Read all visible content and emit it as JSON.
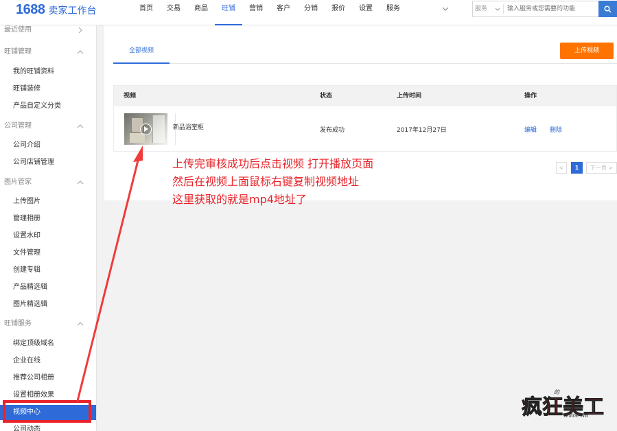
{
  "header": {
    "logo_number": "1688",
    "logo_text": "卖家工作台",
    "nav": [
      "首页",
      "交易",
      "商品",
      "旺铺",
      "营销",
      "客户",
      "分销",
      "报价",
      "设置",
      "服务"
    ],
    "search_scope": "服务",
    "search_placeholder": "输入服务或您需要的功能"
  },
  "sidebar": {
    "items": [
      {
        "label": "最近使用",
        "kind": "group"
      },
      {
        "label": "旺铺管理",
        "kind": "group"
      },
      {
        "label": "我的旺铺资料",
        "kind": "link"
      },
      {
        "label": "旺铺装修",
        "kind": "link"
      },
      {
        "label": "产品自定义分类",
        "kind": "link"
      },
      {
        "label": "公司管理",
        "kind": "group"
      },
      {
        "label": "公司介绍",
        "kind": "link"
      },
      {
        "label": "公司店铺管理",
        "kind": "link"
      },
      {
        "label": "图片管家",
        "kind": "group"
      },
      {
        "label": "上传图片",
        "kind": "link"
      },
      {
        "label": "管理相册",
        "kind": "link"
      },
      {
        "label": "设置水印",
        "kind": "link"
      },
      {
        "label": "文件管理",
        "kind": "link"
      },
      {
        "label": "创建专辑",
        "kind": "link"
      },
      {
        "label": "产品精选辑",
        "kind": "link"
      },
      {
        "label": "图片精选辑",
        "kind": "link"
      },
      {
        "label": "旺铺服务",
        "kind": "group"
      },
      {
        "label": "绑定顶级域名",
        "kind": "link"
      },
      {
        "label": "企业在线",
        "kind": "link"
      },
      {
        "label": "推荐公司相册",
        "kind": "link"
      },
      {
        "label": "设置相册效果",
        "kind": "link"
      },
      {
        "label": "视频中心",
        "kind": "link",
        "active": true
      },
      {
        "label": "公司动态",
        "kind": "link"
      }
    ]
  },
  "main": {
    "tab_all": "全部视频",
    "upload_button": "上传视频",
    "table": {
      "headers": [
        "视频",
        "状态",
        "上传时间",
        "操作"
      ],
      "rows": [
        {
          "title": "新品浴室柜",
          "status": "发布成功",
          "date": "2017年12月27日",
          "edit": "编辑",
          "delete": "删除"
        }
      ]
    },
    "pagination": {
      "prev": "<",
      "current": "1",
      "next": "下一页 >"
    }
  },
  "annotation": {
    "lines": [
      "上传完审核成功后点击视频 打开播放页面",
      "然后在视频上面鼠标右键复制视频地址",
      "这里获取的就是mp4地址了"
    ]
  },
  "watermark": {
    "big": "疯狂美工",
    "small": "online-NB",
    "tiny": "的"
  },
  "colors": {
    "accent": "#2e6bd9",
    "orange": "#ff7300",
    "annotation": "#e8242a"
  }
}
